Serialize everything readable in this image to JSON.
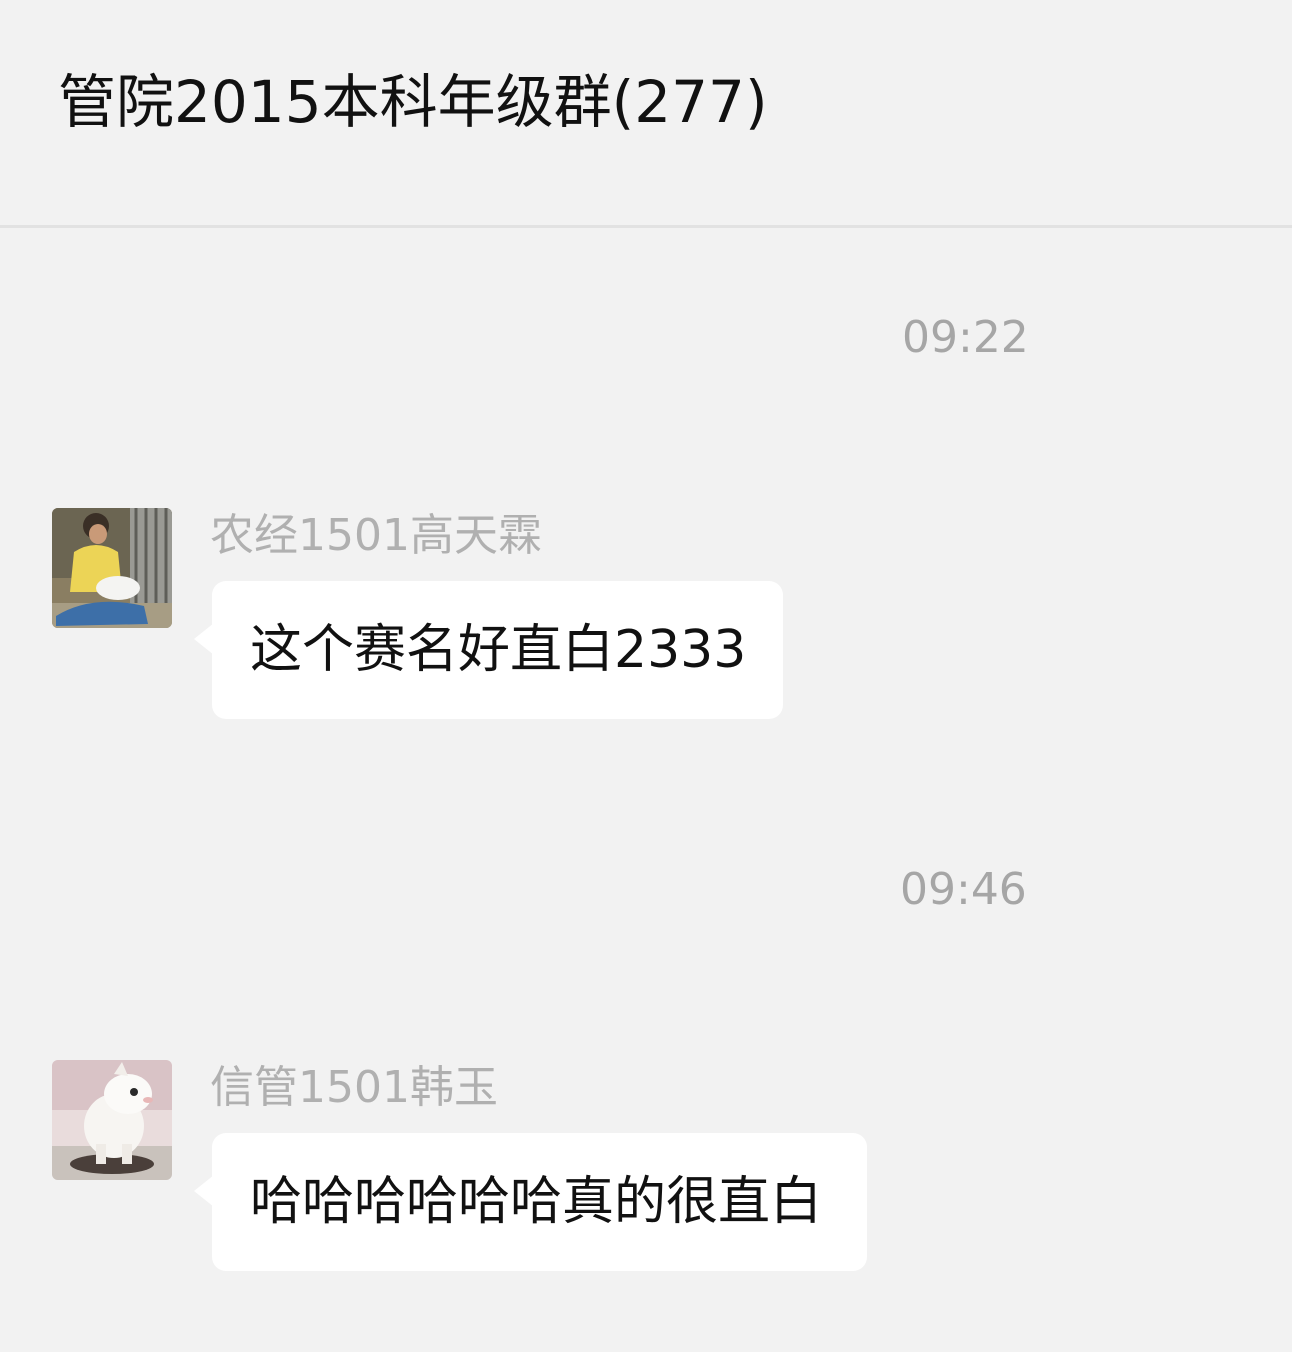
{
  "header": {
    "title": "管院2015本科年级群(277)"
  },
  "messages": [
    {
      "time": "09:22",
      "sender": "农经1501高天霖",
      "avatar_icon": "person-holding-cat-photo",
      "text": "这个赛名好直白2333"
    },
    {
      "time": "09:46",
      "sender": "信管1501韩玉",
      "avatar_icon": "white-plush-toy-photo",
      "text": "哈哈哈哈哈哈真的很直白"
    }
  ],
  "colors": {
    "background": "#f2f2f2",
    "bubble": "#ffffff",
    "secondary_text": "#a6a6a6",
    "primary_text": "#111111"
  }
}
